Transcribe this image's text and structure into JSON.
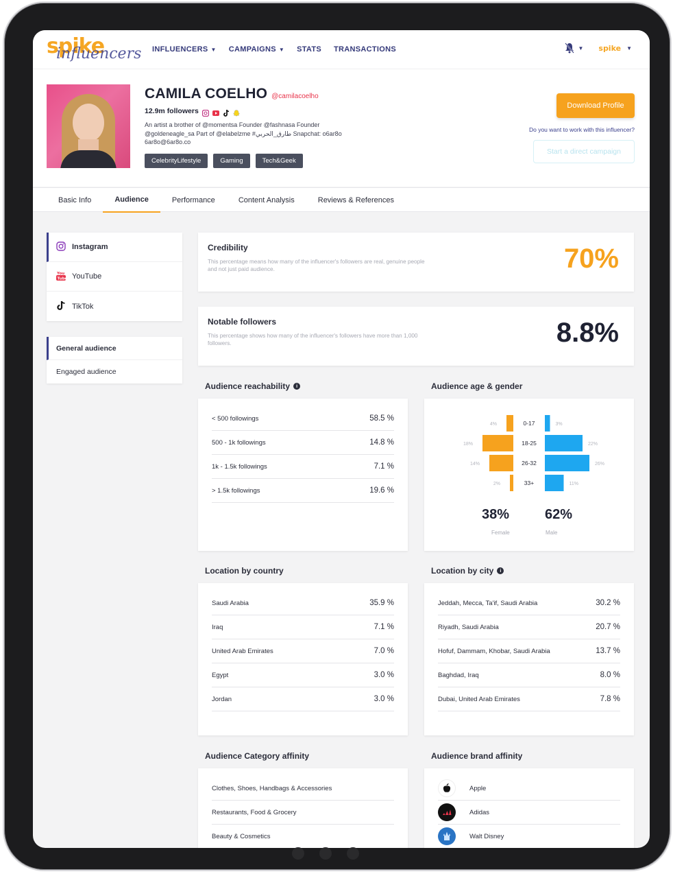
{
  "nav": {
    "logo_text": "spike",
    "logo_script": "influencers",
    "items": [
      "INFLUENCERS",
      "CAMPAIGNS",
      "STATS",
      "TRANSACTIONS"
    ],
    "user_logo": "spike"
  },
  "profile": {
    "name": "CAMILA COELHO",
    "handle": "@camilacoelho",
    "followers": "12.9m followers",
    "bio": "An artist a brother of @momentsa Founder @fashnasa Founder @goldeneagle_sa Part of @elabelzme #طارق_الحربي Snapchat: o6ar8o 6ar8o@6ar8o.co",
    "tags": [
      "CelebrityLifestyle",
      "Gaming",
      "Tech&Geek"
    ],
    "download_label": "Download Profile",
    "work_question": "Do you want to work with this influencer?",
    "campaign_label": "Start a direct campaign"
  },
  "tabs": [
    "Basic Info",
    "Audience",
    "Performance",
    "Content Analysis",
    "Reviews & References"
  ],
  "sidebar": {
    "platforms": [
      "Instagram",
      "YouTube",
      "TikTok"
    ],
    "audience_types": [
      "General audience",
      "Engaged audience"
    ]
  },
  "credibility": {
    "title": "Credibility",
    "desc": "This percentage means how many of the influencer's followers are real, genuine people and not just paid audience.",
    "value": "70%",
    "color": "#f6a21e"
  },
  "notable": {
    "title": "Notable followers",
    "desc": "This percentage shows how many of the influencer's followers have more than 1,000 followers.",
    "value": "8.8%",
    "color": "#1f2233"
  },
  "reachability": {
    "title": "Audience reachability",
    "rows": [
      {
        "label": "< 500 followings",
        "value": "58.5 %"
      },
      {
        "label": "500 - 1k followings",
        "value": "14.8 %"
      },
      {
        "label": "1k - 1.5k followings",
        "value": "7.1 %"
      },
      {
        "label": "> 1.5k followings",
        "value": "19.6 %"
      }
    ]
  },
  "age_gender": {
    "title": "Audience age & gender",
    "female_color": "#f6a21e",
    "male_color": "#1ea7f0",
    "female_pct": "38%",
    "male_pct": "62%",
    "female_label": "Female",
    "male_label": "Male"
  },
  "chart_data": {
    "type": "bar",
    "title": "Audience age & gender",
    "categories": [
      "0-17",
      "18-25",
      "26-32",
      "33+"
    ],
    "series": [
      {
        "name": "Female",
        "values": [
          4,
          18,
          14,
          2
        ],
        "labels": [
          "4%",
          "18%",
          "14%",
          "2%"
        ]
      },
      {
        "name": "Male",
        "values": [
          3,
          22,
          26,
          11
        ],
        "labels": [
          "3%",
          "22%",
          "26%",
          "11%"
        ]
      }
    ]
  },
  "country": {
    "title": "Location by country",
    "rows": [
      {
        "label": "Saudi Arabia",
        "value": "35.9 %"
      },
      {
        "label": "Iraq",
        "value": "7.1 %"
      },
      {
        "label": "United Arab Emirates",
        "value": "7.0 %"
      },
      {
        "label": "Egypt",
        "value": "3.0 %"
      },
      {
        "label": "Jordan",
        "value": "3.0 %"
      }
    ]
  },
  "city": {
    "title": "Location by city",
    "rows": [
      {
        "label": "Jeddah, Mecca, Ta'if, Saudi Arabia",
        "value": "30.2 %"
      },
      {
        "label": "Riyadh, Saudi Arabia",
        "value": "20.7 %"
      },
      {
        "label": "Hofuf, Dammam, Khobar, Saudi Arabia",
        "value": "13.7 %"
      },
      {
        "label": "Baghdad, Iraq",
        "value": "8.0 %"
      },
      {
        "label": "Dubai, United Arab Emirates",
        "value": "7.8 %"
      }
    ]
  },
  "category_affinity": {
    "title": "Audience Category affinity",
    "rows": [
      "Clothes, Shoes, Handbags & Accessories",
      "Restaurants, Food & Grocery",
      "Beauty & Cosmetics"
    ]
  },
  "brand_affinity": {
    "title": "Audience brand affinity",
    "rows": [
      {
        "label": "Apple",
        "icon": "apple-icon"
      },
      {
        "label": "Adidas",
        "icon": "adidas-icon"
      },
      {
        "label": "Walt Disney",
        "icon": "disney-icon"
      }
    ]
  }
}
